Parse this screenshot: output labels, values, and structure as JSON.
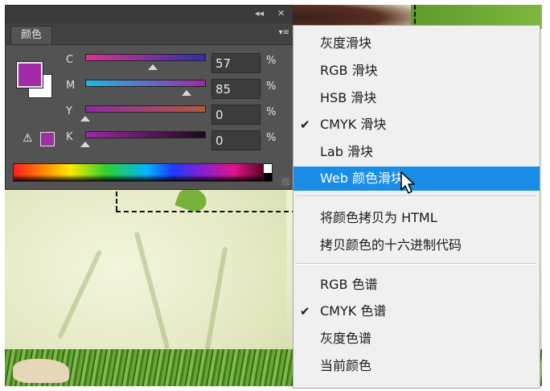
{
  "panel": {
    "tab": "颜色",
    "collapse_label": "◂◂",
    "close_label": "✕",
    "menu_label": "▾≡",
    "foreground_color": "#a12ca6",
    "background_color": "#ffffff",
    "channels": [
      {
        "letter": "C",
        "value": "57",
        "unit": "%",
        "level": 57
      },
      {
        "letter": "M",
        "value": "85",
        "unit": "%",
        "level": 85
      },
      {
        "letter": "Y",
        "value": "0",
        "unit": "%",
        "level": 0
      },
      {
        "letter": "K",
        "value": "0",
        "unit": "%",
        "level": 0
      }
    ],
    "gamut_warning_icon": "⚠"
  },
  "menu": {
    "items": [
      {
        "label": "灰度滑块",
        "checked": false
      },
      {
        "label": "RGB 滑块",
        "checked": false
      },
      {
        "label": "HSB 滑块",
        "checked": false
      },
      {
        "label": "CMYK 滑块",
        "checked": true
      },
      {
        "label": "Lab 滑块",
        "checked": false
      },
      {
        "label": "Web 颜色滑块",
        "checked": false,
        "highlighted": true
      },
      {
        "label": "将颜色拷贝为 HTML",
        "checked": false
      },
      {
        "label": "拷贝颜色的十六进制代码",
        "checked": false
      },
      {
        "label": "RGB 色谱",
        "checked": false
      },
      {
        "label": "CMYK 色谱",
        "checked": true
      },
      {
        "label": "灰度色谱",
        "checked": false
      },
      {
        "label": "当前颜色",
        "checked": false
      }
    ],
    "check_glyph": "✔",
    "highlight_color": "#1a8ee6"
  }
}
